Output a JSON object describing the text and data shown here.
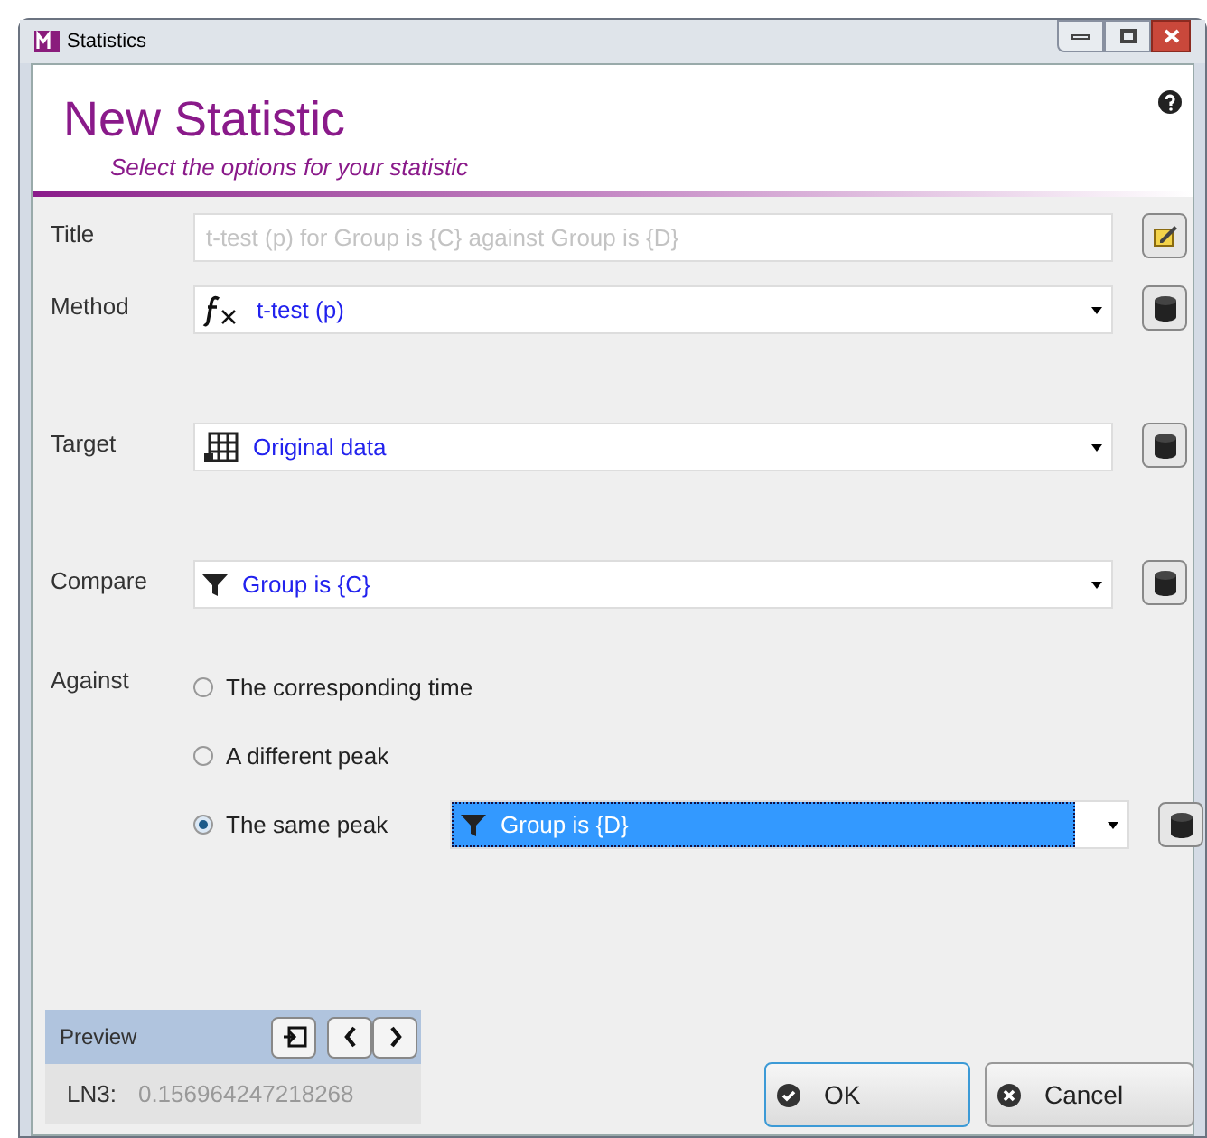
{
  "window": {
    "title": "Statistics"
  },
  "header": {
    "title": "New Statistic",
    "subtitle": "Select the options for your statistic"
  },
  "fields": [
    {
      "kind": "text",
      "label": "Title",
      "placeholder": "t-test (p) for Group is {C} against Group is {D}"
    },
    {
      "kind": "select",
      "label": "Method",
      "value": "t-test (p)"
    },
    {
      "kind": "select",
      "label": "Target",
      "value": "Original data"
    },
    {
      "kind": "select",
      "label": "Compare",
      "value": "Group is {C}"
    }
  ],
  "against": {
    "label": "Against",
    "options": [
      {
        "label": "The corresponding time",
        "selected": false
      },
      {
        "label": "A different peak",
        "selected": false
      },
      {
        "label": "The same peak",
        "selected": true,
        "select_value": "Group is {D}"
      }
    ]
  },
  "preview": {
    "title": "Preview",
    "key": "LN3:",
    "value": "0.156964247218268"
  },
  "buttons": [
    {
      "kind": "ok",
      "label": "OK"
    },
    {
      "kind": "cancel",
      "label": "Cancel"
    }
  ]
}
